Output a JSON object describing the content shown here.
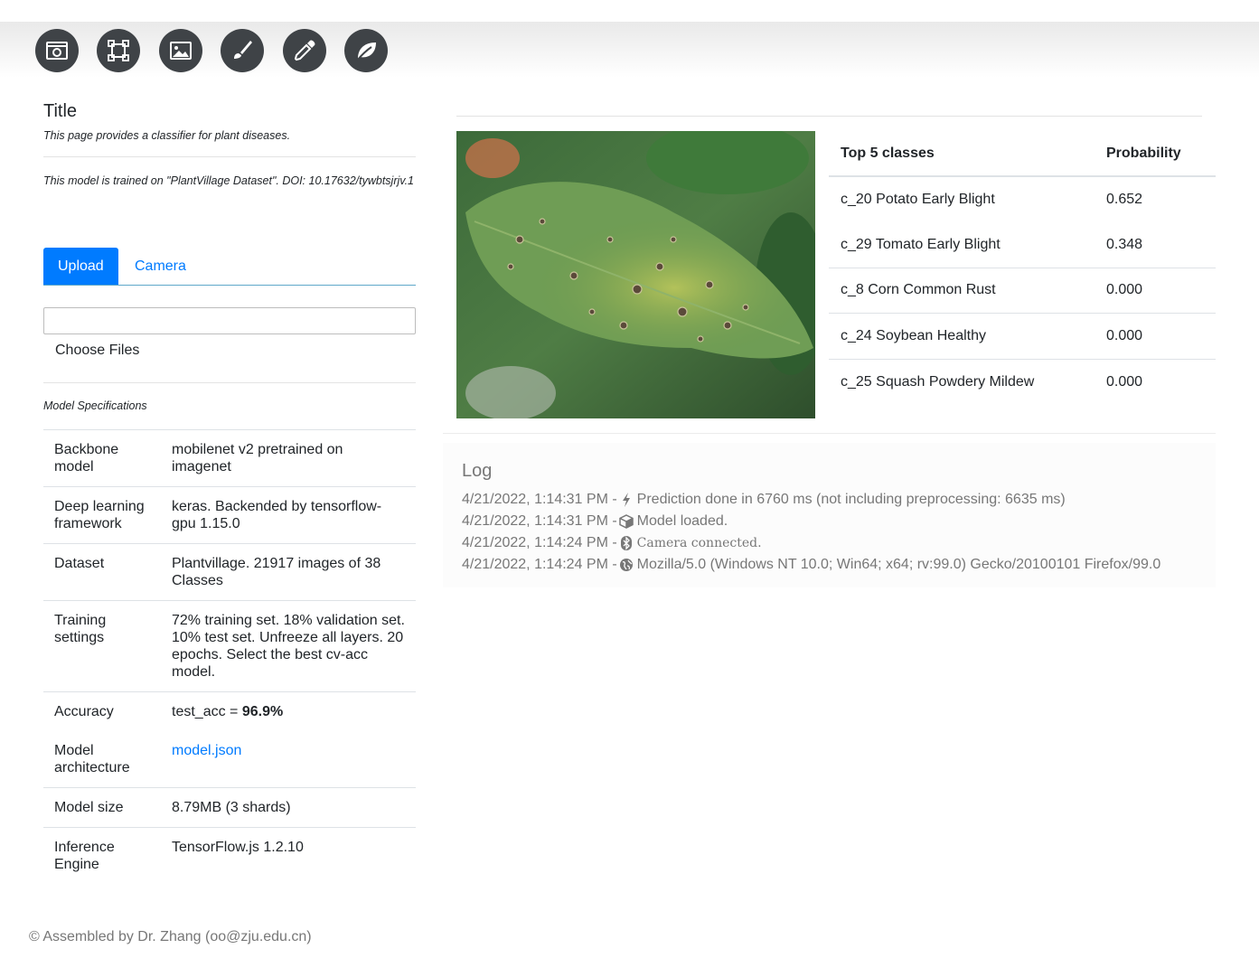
{
  "toolbar": {
    "buttons": [
      {
        "icon": "camera-window-icon"
      },
      {
        "icon": "crop-frame-icon"
      },
      {
        "icon": "image-icon"
      },
      {
        "icon": "paint-brush-icon"
      },
      {
        "icon": "eyedropper-icon"
      },
      {
        "icon": "leaf-icon"
      }
    ]
  },
  "page": {
    "title": "Title",
    "description": "This page provides a classifier for plant diseases.",
    "model_note": "This model is trained on \"PlantVillage Dataset\". DOI: 10.17632/tywbtsjrjv.1"
  },
  "tabs": {
    "upload": "Upload",
    "camera": "Camera"
  },
  "file": {
    "choose_label": "Choose Files"
  },
  "specs": {
    "title": "Model Specifications",
    "rows": [
      {
        "key": "Backbone model",
        "value": "mobilenet v2 pretrained on imagenet"
      },
      {
        "key": "Deep learning framework",
        "value": "keras. Backended by tensorflow-gpu 1.15.0"
      },
      {
        "key": "Dataset",
        "value": "Plantvillage. 21917 images of 38 Classes"
      },
      {
        "key": "Training settings",
        "value": "72% training set. 18% validation set. 10% test set. Unfreeze all layers. 20 epochs. Select the best cv-acc model."
      },
      {
        "key": "Accuracy",
        "value_prefix": "test_acc = ",
        "value_bold": "96.9%"
      },
      {
        "key": "Model architecture",
        "link": "model.json"
      },
      {
        "key": "Model size",
        "value": "8.79MB (3 shards)"
      },
      {
        "key": "Inference Engine",
        "value": "TensorFlow.js 1.2.10"
      }
    ]
  },
  "predictions": {
    "header_class": "Top 5 classes",
    "header_prob": "Probability",
    "rows": [
      {
        "class": "c_20 Potato Early Blight",
        "prob": "0.652"
      },
      {
        "class": "c_29 Tomato Early Blight",
        "prob": "0.348"
      },
      {
        "class": "c_8 Corn Common Rust",
        "prob": "0.000"
      },
      {
        "class": "c_24 Soybean Healthy",
        "prob": "0.000"
      },
      {
        "class": "c_25 Squash Powdery Mildew",
        "prob": "0.000"
      }
    ]
  },
  "log": {
    "title": "Log",
    "entries": [
      {
        "time": "4/21/2022, 1:14:31 PM - ",
        "icon": "bolt-icon",
        "text": "Prediction done in 6760 ms (not including preprocessing: 6635 ms)"
      },
      {
        "time": "4/21/2022, 1:14:31 PM - ",
        "icon": "cube-icon",
        "text": "Model loaded."
      },
      {
        "time": "4/21/2022, 1:14:24 PM - ",
        "icon": "bluetooth-icon",
        "text": "Camera connected."
      },
      {
        "time": "4/21/2022, 1:14:24 PM - ",
        "icon": "globe-icon",
        "text": "Mozilla/5.0 (Windows NT 10.0; Win64; x64; rv:99.0) Gecko/20100101 Firefox/99.0"
      }
    ]
  },
  "footer": {
    "text": "© Assembled by Dr. Zhang (oo@zju.edu.cn)"
  }
}
